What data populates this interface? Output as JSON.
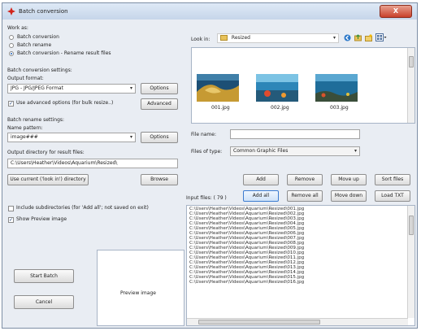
{
  "window": {
    "title": "Batch conversion",
    "close_glyph": "X"
  },
  "work_as": {
    "label": "Work as:",
    "options": [
      "Batch conversion",
      "Batch rename",
      "Batch conversion - Rename result files"
    ],
    "selected": 2
  },
  "conversion": {
    "section_label": "Batch conversion settings:",
    "output_format_label": "Output format:",
    "output_format_value": "JPG - JPG/JPEG Format",
    "options_button": "Options",
    "advanced_checkbox_label": "Use advanced options (for bulk resize..)",
    "advanced_checked": true,
    "advanced_button": "Advanced"
  },
  "rename": {
    "section_label": "Batch rename settings:",
    "name_pattern_label": "Name pattern:",
    "name_pattern_value": "image###",
    "options_button": "Options"
  },
  "output": {
    "label": "Output directory for result files:",
    "path": "C:\\Users\\Heather\\Videos\\Aquarium\\Resized\\",
    "use_current_button": "Use current ('look in') directory",
    "browse_button": "Browse"
  },
  "checks": {
    "include_subdirs_label": "Include subdirectories (for 'Add all'; not saved on exit)",
    "include_subdirs_checked": false,
    "show_preview_label": "Show Preview image",
    "show_preview_checked": true
  },
  "actions": {
    "start_batch": "Start Batch",
    "cancel": "Cancel"
  },
  "preview": {
    "label": "Preview image"
  },
  "browser": {
    "look_in_label": "Look in:",
    "look_in_value": "Resized",
    "thumbnails": [
      {
        "name": "001.jpg"
      },
      {
        "name": "002.jpg"
      },
      {
        "name": "003.jpg"
      }
    ],
    "file_name_label": "File name:",
    "file_name_value": "",
    "file_type_label": "Files of type:",
    "file_type_value": "Common Graphic Files"
  },
  "list_buttons": {
    "add": "Add",
    "remove": "Remove",
    "move_up": "Move up",
    "sort_files": "Sort files",
    "add_all": "Add all",
    "remove_all": "Remove all",
    "move_down": "Move down",
    "load_txt": "Load TXT"
  },
  "input_files": {
    "label": "Input files: ( 79 )",
    "items": [
      "C:\\Users\\Heather\\Videos\\Aquarium\\Resized\\001.jpg",
      "C:\\Users\\Heather\\Videos\\Aquarium\\Resized\\002.jpg",
      "C:\\Users\\Heather\\Videos\\Aquarium\\Resized\\003.jpg",
      "C:\\Users\\Heather\\Videos\\Aquarium\\Resized\\004.jpg",
      "C:\\Users\\Heather\\Videos\\Aquarium\\Resized\\005.jpg",
      "C:\\Users\\Heather\\Videos\\Aquarium\\Resized\\006.jpg",
      "C:\\Users\\Heather\\Videos\\Aquarium\\Resized\\007.jpg",
      "C:\\Users\\Heather\\Videos\\Aquarium\\Resized\\008.jpg",
      "C:\\Users\\Heather\\Videos\\Aquarium\\Resized\\009.jpg",
      "C:\\Users\\Heather\\Videos\\Aquarium\\Resized\\010.jpg",
      "C:\\Users\\Heather\\Videos\\Aquarium\\Resized\\011.jpg",
      "C:\\Users\\Heather\\Videos\\Aquarium\\Resized\\012.jpg",
      "C:\\Users\\Heather\\Videos\\Aquarium\\Resized\\013.jpg",
      "C:\\Users\\Heather\\Videos\\Aquarium\\Resized\\014.jpg",
      "C:\\Users\\Heather\\Videos\\Aquarium\\Resized\\015.jpg",
      "C:\\Users\\Heather\\Videos\\Aquarium\\Resized\\016.jpg"
    ]
  },
  "colors": {
    "accent": "#3b7bd0",
    "close": "#c9412b",
    "window_bg": "#e9edf3"
  }
}
